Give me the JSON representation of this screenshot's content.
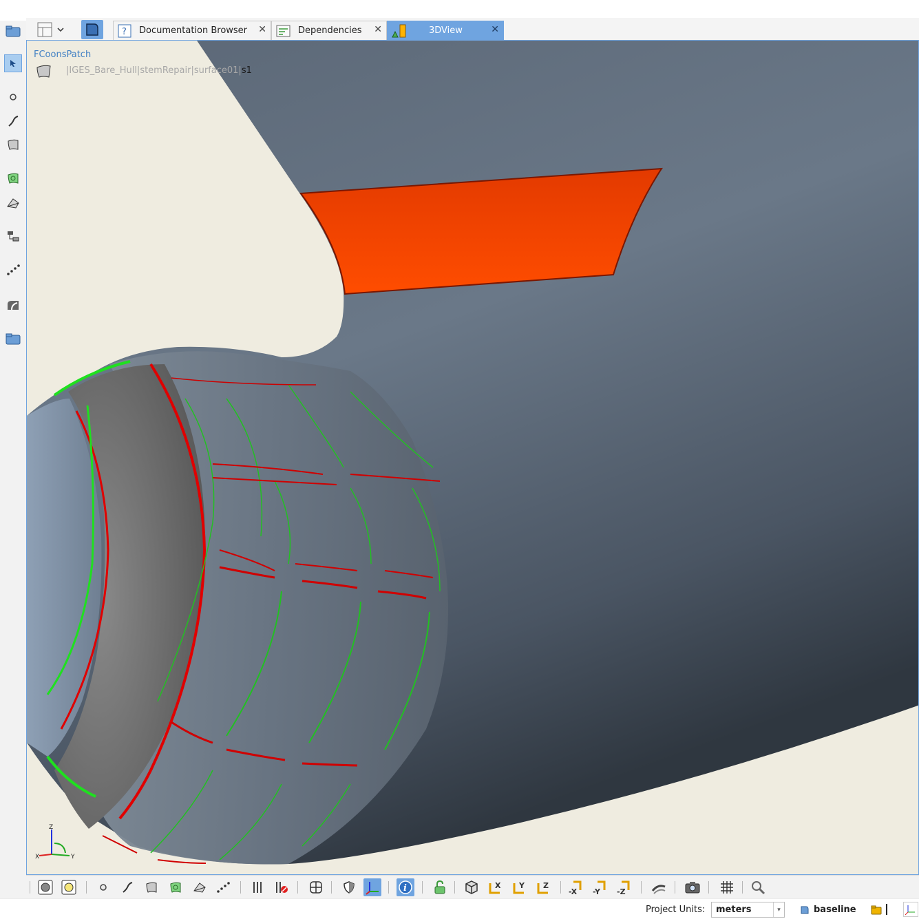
{
  "tabs": [
    {
      "label": "Documentation Browser",
      "close": "✕",
      "icon": "help-icon"
    },
    {
      "label": "Dependencies",
      "close": "✕",
      "icon": "dependencies-icon"
    },
    {
      "label": "3DView",
      "close": "✕",
      "icon": "3dview-icon",
      "active": true
    }
  ],
  "viewport": {
    "entity_type": "FCoonsPatch",
    "path_prefix": "|IGES_Bare_Hull|stemRepair|surface01|",
    "path_selected": "s1",
    "axes": {
      "z": "Z",
      "x": "X",
      "y": "Y"
    }
  },
  "left_toolbar": [
    "folder-icon",
    "layout-icon",
    "chevron-down-icon",
    "select-frame-icon",
    "pointer-icon",
    "point-icon",
    "curve-icon",
    "surface-icon",
    "coons-patch-icon",
    "solid-icon",
    "tree-icon",
    "points-icon",
    "blend-icon",
    "folder-icon"
  ],
  "bottom_toolbar": {
    "axis_labels": {
      "x": "X",
      "y": "Y",
      "z": "Z",
      "nx": "-X",
      "ny": "-Y",
      "nz": "-Z"
    },
    "active": [
      "axes-icon",
      "info-icon"
    ]
  },
  "status": {
    "project_units_label": "Project Units:",
    "project_units_value": "meters",
    "design_name": "baseline"
  },
  "colors": {
    "accent": "#6fa4e0",
    "hull": "#5f6b78",
    "patch": "#ff4a00",
    "background": "#efece0"
  }
}
